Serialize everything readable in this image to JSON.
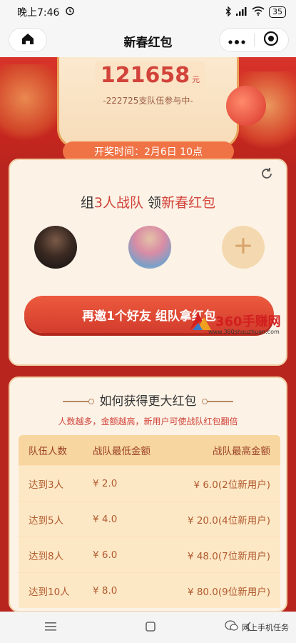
{
  "status_bar": {
    "time": "晚上7:46",
    "battery": "35"
  },
  "nav": {
    "title": "新春红包"
  },
  "hero": {
    "amount": "121658",
    "unit": "元",
    "teams_text": "-222725支队伍参与中-",
    "lottery_time": "开奖时间：2月6日 10点"
  },
  "team": {
    "title_pre": "组",
    "title_hl1": "3人战队",
    "title_mid": " 领",
    "title_hl2": "新春红包",
    "invite_label": "再邀1个好友 组队拿红包"
  },
  "watermark": {
    "name": "360手赚网",
    "url": "www.360shouzhuan.com"
  },
  "info": {
    "title": "如何获得更大红包",
    "subtitle": "人数越多，金额越高，新用户可使战队红包翻倍",
    "headers": [
      "队伍人数",
      "战队最低金额",
      "战队最高金额"
    ],
    "rows": [
      [
        "达到3人",
        "¥ 2.0",
        "¥ 6.0(2位新用户)"
      ],
      [
        "达到5人",
        "¥ 4.0",
        "¥ 20.0(4位新用户)"
      ],
      [
        "达到8人",
        "¥ 6.0",
        "¥ 48.0(7位新用户)"
      ],
      [
        "达到10人",
        "¥ 8.0",
        "¥ 80.0(9位新用户)"
      ]
    ]
  },
  "bottom": {
    "wechat_label": "网上手机任务"
  },
  "colors": {
    "accent": "#d2433a",
    "page_bg": "#b8251e",
    "card_bg": "#fcf2e6",
    "button": "#e04a36"
  }
}
